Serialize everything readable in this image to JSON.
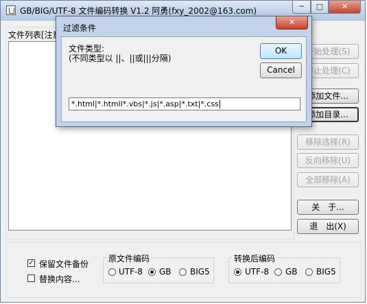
{
  "window": {
    "title": "GB/BIG/UTF-8 文件编码转换 V1.2  阿勇(fxy_2002@163.com)",
    "min_glyph": "─",
    "max_glyph": "□",
    "close_glyph": "✕"
  },
  "file_list": {
    "label": "文件列表[注意"
  },
  "buttons": {
    "start": "开始处理(S)",
    "stop": "停止处理(C)",
    "add_file": "添加文件...",
    "add_dir": "添加目录...",
    "remove_selected": "移除选择(R)",
    "reverse_remove": "反向移除(U)",
    "remove_all": "全部移除(A)",
    "about": "关　于...",
    "exit": "退　出(X)"
  },
  "options": {
    "backup_label": "保留文件备份",
    "backup_checked": true,
    "replace_label": "替换内容...",
    "replace_checked": false
  },
  "source_encoding": {
    "legend": "原文件编码",
    "options": [
      "UTF-8",
      "GB",
      "BIG5"
    ],
    "selected": "GB"
  },
  "target_encoding": {
    "legend": "转换后编码",
    "options": [
      "UTF-8",
      "GB",
      "BIG5"
    ],
    "selected": "UTF-8"
  },
  "dialog": {
    "title": "过滤条件",
    "label_line1": "文件类型:",
    "label_line2": "(不同类型以 ||、||或|||分隔)",
    "ok": "OK",
    "cancel": "Cancel",
    "filter_value": "*.html|*.htmll*.vbs|*.js|*.asp|*.txt|*.css",
    "close_glyph": "✕"
  },
  "colors": {
    "title_gradient_top": "#dfe9f5",
    "close_red": "#c8422c",
    "dialog_frame": "#c3d4ea",
    "disabled_text": "#a0a0a0"
  }
}
